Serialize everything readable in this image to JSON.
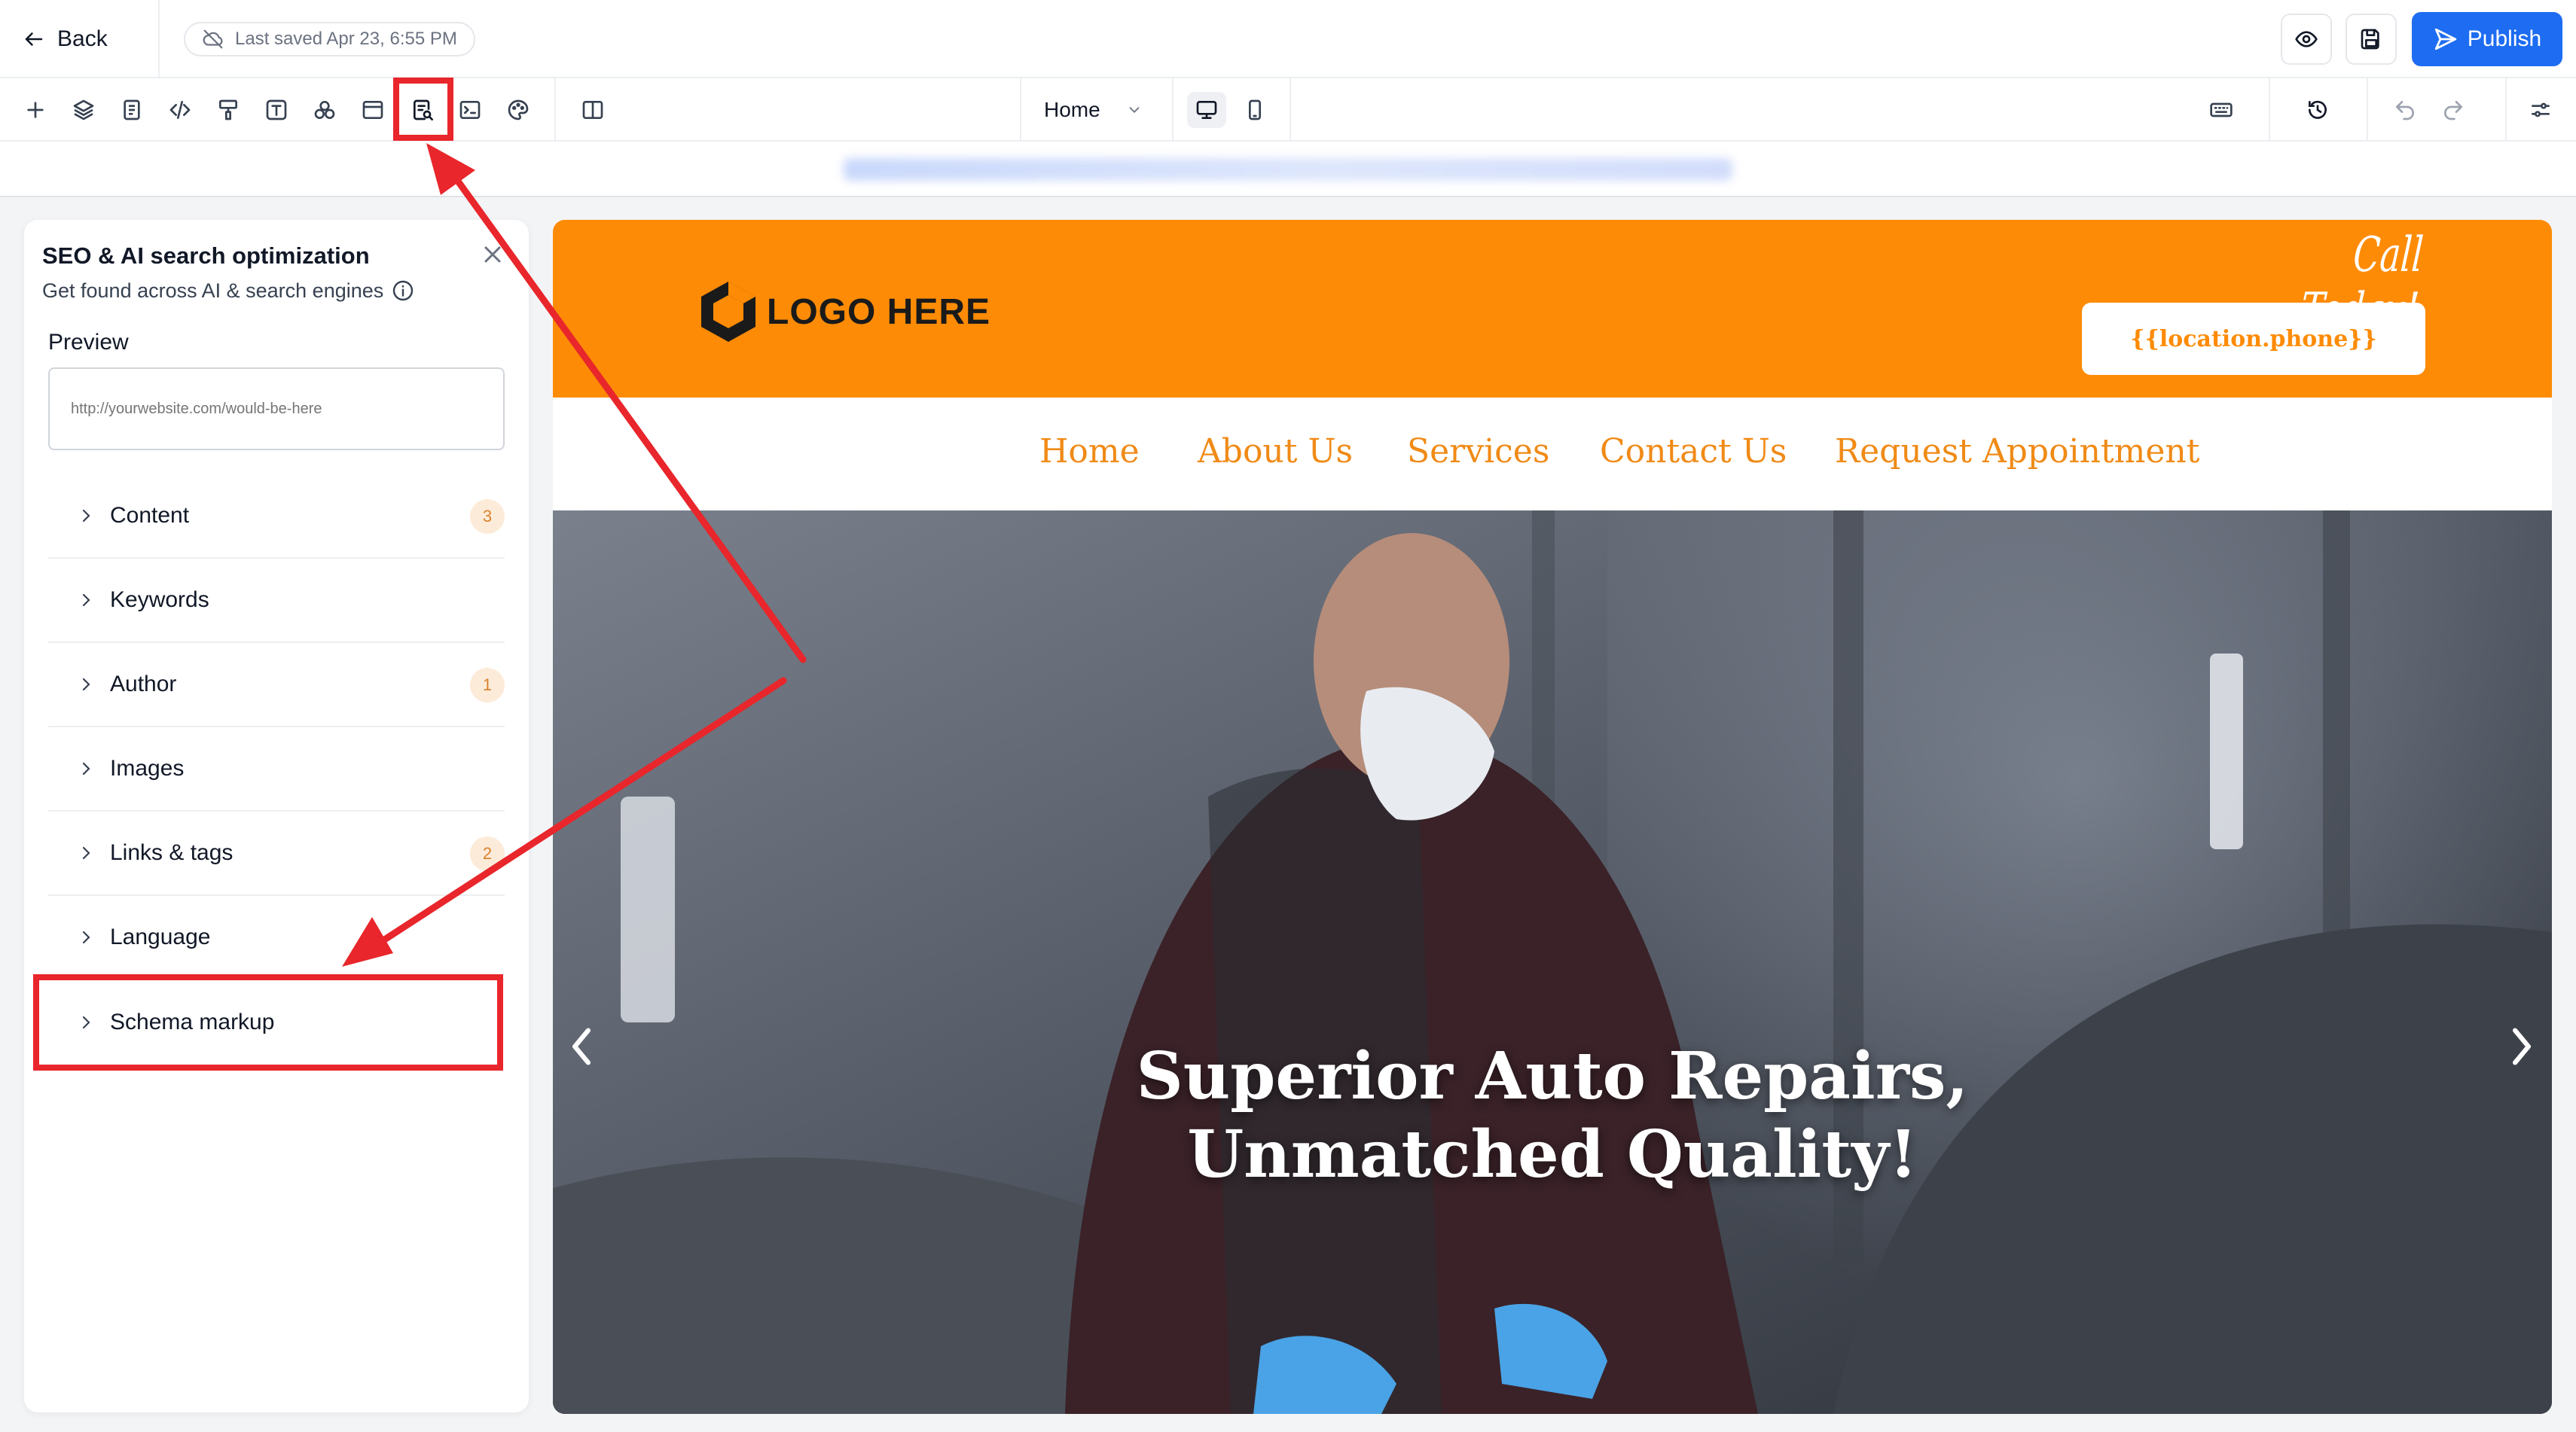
{
  "topbar": {
    "back_label": "Back",
    "last_saved": "Last saved Apr 23, 6:55 PM",
    "publish_label": "Publish"
  },
  "toolbar": {
    "page_selector": "Home",
    "icons": [
      "plus-icon",
      "layers-icon",
      "page-icon",
      "code-icon",
      "paint-roller-icon",
      "text-icon",
      "shapes-icon",
      "window-icon",
      "seo-search-icon",
      "terminal-icon",
      "palette-icon",
      "split-view-icon"
    ]
  },
  "seo_panel": {
    "title": "SEO & AI search optimization",
    "subtitle": "Get found across AI & search engines",
    "preview_label": "Preview",
    "preview_placeholder": "http://yourwebsite.com/would-be-here",
    "sections": [
      {
        "label": "Content",
        "badge": "3"
      },
      {
        "label": "Keywords",
        "badge": ""
      },
      {
        "label": "Author",
        "badge": "1"
      },
      {
        "label": "Images",
        "badge": ""
      },
      {
        "label": "Links & tags",
        "badge": "2"
      },
      {
        "label": "Language",
        "badge": ""
      },
      {
        "label": "Schema markup",
        "badge": ""
      }
    ]
  },
  "site": {
    "logo_text": "LOGO HERE",
    "call_today": "Call Today!",
    "phone_button": "{{location.phone}}",
    "nav": [
      "Home",
      "About Us",
      "Services",
      "Contact Us",
      "Request Appointment"
    ],
    "hero_line1": "Superior Auto Repairs,",
    "hero_line2": "Unmatched Quality!"
  },
  "colors": {
    "accent_blue": "#1d6cf2",
    "site_orange": "#fe8b06",
    "annotation_red": "#e8262b",
    "badge_bg": "#fdebd9",
    "badge_text": "#d9822b"
  }
}
